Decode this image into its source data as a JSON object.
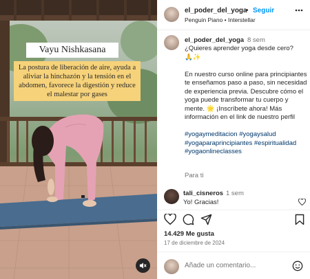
{
  "media": {
    "title": "Vayu Nishkasana",
    "caption": "La postura de liberación de aire, ayuda a aliviar la hinchazón y la tensión en el abdomen, favorece la digestión y reduce el malestar por gases"
  },
  "header": {
    "username": "el_poder_del_yoga",
    "separator": "•",
    "follow_label": "Seguir",
    "audio": "Penguin Piano • Interstellar"
  },
  "post": {
    "username": "el_poder_del_yoga",
    "time": "8 sem",
    "line1": "¿Quieres aprender yoga desde cero?",
    "line1b": "🙏✨",
    "para2": "En nuestro curso online para principiantes te enseñamos paso a paso, sin necesidad de experiencia previa. Descubre cómo el yoga puede transformar tu cuerpo y mente. 🌟 ¡Inscríbete ahora! Más información en el link de nuestro perfil",
    "hashtags": "#yogaymeditacion #yogaysalud #yogaparaprincipiantes #espiritualidad #yogaonlineclasses",
    "see_translation": "Para ti"
  },
  "comment": {
    "username": "tali_cisneros",
    "time": "1 sem",
    "text": "Yo! Gracias!"
  },
  "stats": {
    "likes": "14.429 Me gusta",
    "date": "17 de diciembre de 2024"
  },
  "add_comment": {
    "placeholder": "Añade un comentario..."
  },
  "colors": {
    "follow": "#0095f6",
    "hashtag": "#00376b",
    "caption_bg": "#f6d27a"
  }
}
